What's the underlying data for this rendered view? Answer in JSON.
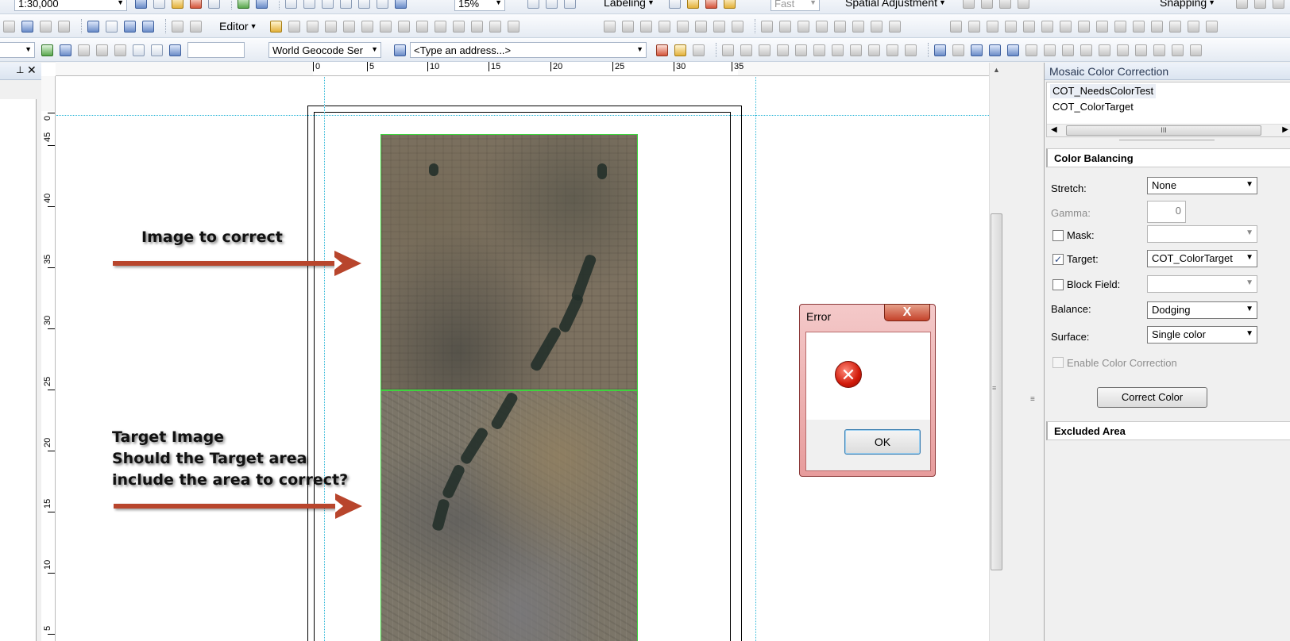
{
  "toolbar": {
    "scale_value": "1:30,000",
    "editor_label": "Editor",
    "zoom_value": "15%",
    "labeling_label": "Labeling",
    "quality_value": "Fast",
    "spatial_adjustment_label": "Spatial Adjustment",
    "snapping_label": "Snapping",
    "geocoder_value": "World Geocode Ser",
    "address_placeholder": "<Type an address...>",
    "find_value": ""
  },
  "ruler": {
    "top_ticks": [
      "0",
      "5",
      "10",
      "15",
      "20",
      "25",
      "30",
      "35"
    ],
    "left_ticks": [
      "0",
      "45",
      "40",
      "35",
      "30",
      "25",
      "20",
      "15",
      "10",
      "5"
    ]
  },
  "annotations": {
    "top_label": "Image to correct",
    "bottom_line1": "Target Image",
    "bottom_line2": "Should the Target area",
    "bottom_line3": "include the area to correct?"
  },
  "error_dialog": {
    "title": "Error",
    "close_glyph": "X",
    "icon_glyph": "✕",
    "ok_label": "OK"
  },
  "panel": {
    "title": "Mosaic Color Correction",
    "list_items": [
      "COT_NeedsColorTest",
      "COT_ColorTarget"
    ],
    "scroll_grip": "III",
    "color_balancing": {
      "header": "Color Balancing",
      "stretch_label": "Stretch:",
      "stretch_value": "None",
      "gamma_label": "Gamma:",
      "gamma_value": "0",
      "mask_label": "Mask:",
      "mask_checked": false,
      "mask_value": "",
      "target_label": "Target:",
      "target_checked": true,
      "target_value": "COT_ColorTarget",
      "block_field_label": "Block Field:",
      "block_field_checked": false,
      "block_field_value": "",
      "balance_label": "Balance:",
      "balance_value": "Dodging",
      "surface_label": "Surface:",
      "surface_value": "Single color",
      "enable_label": "Enable Color Correction",
      "enable_checked": false,
      "correct_button": "Correct Color"
    },
    "excluded_area": {
      "header": "Excluded Area"
    }
  },
  "icons": {
    "check_glyph": "✓",
    "dropdown_glyph": "▼",
    "pin_glyph": "⊥",
    "close_glyph": "✕",
    "scroll_up_glyph": "▲",
    "scroll_left_glyph": "◀",
    "scroll_right_glyph": "▶",
    "grip_glyph": "≡"
  },
  "colors": {
    "arrow": "#b8452c",
    "guide": "#2fb8d8",
    "image_border": "#3ed43e",
    "error_frame": "#e79c9c"
  }
}
